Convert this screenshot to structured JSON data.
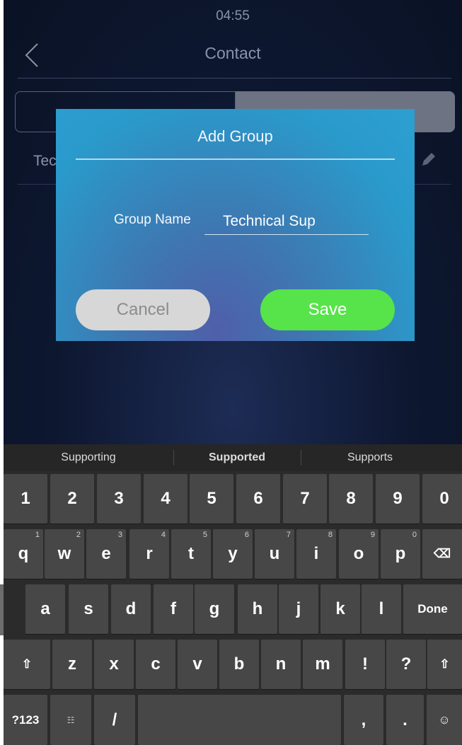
{
  "status_bar": {
    "time": "04:55"
  },
  "header": {
    "title": "Contact"
  },
  "list": {
    "row_text": "Tec"
  },
  "dialog": {
    "title": "Add Group",
    "field_label": "Group Name",
    "field_value": "Technical Sup",
    "cancel_label": "Cancel",
    "save_label": "Save"
  },
  "keyboard": {
    "suggestions": [
      "Supporting",
      "Supported",
      "Supports"
    ],
    "number_row": [
      "1",
      "2",
      "3",
      "4",
      "5",
      "6",
      "7",
      "8",
      "9",
      "0"
    ],
    "row1": [
      {
        "k": "q",
        "hint": "1"
      },
      {
        "k": "w",
        "hint": "2"
      },
      {
        "k": "e",
        "hint": "3"
      },
      {
        "k": "r",
        "hint": "4"
      },
      {
        "k": "t",
        "hint": "5"
      },
      {
        "k": "y",
        "hint": "6"
      },
      {
        "k": "u",
        "hint": "7"
      },
      {
        "k": "i",
        "hint": "8"
      },
      {
        "k": "o",
        "hint": "9"
      },
      {
        "k": "p",
        "hint": "0"
      }
    ],
    "row2": [
      "a",
      "s",
      "d",
      "f",
      "g",
      "h",
      "j",
      "k",
      "l"
    ],
    "done_label": "Done",
    "row3": [
      "z",
      "x",
      "c",
      "v",
      "b",
      "n",
      "m",
      "!",
      "?"
    ],
    "mode_label": "?123",
    "lang_glyph": "☷",
    "slash": "/",
    "comma": ",",
    "period": ".",
    "emoji_glyph": "☺",
    "shift_glyph": "⇧",
    "backspace_glyph": "⌫"
  },
  "colors": {
    "save": "#57e34a",
    "cancel": "#d7d7d7",
    "dialog": "#2c9fd0"
  }
}
